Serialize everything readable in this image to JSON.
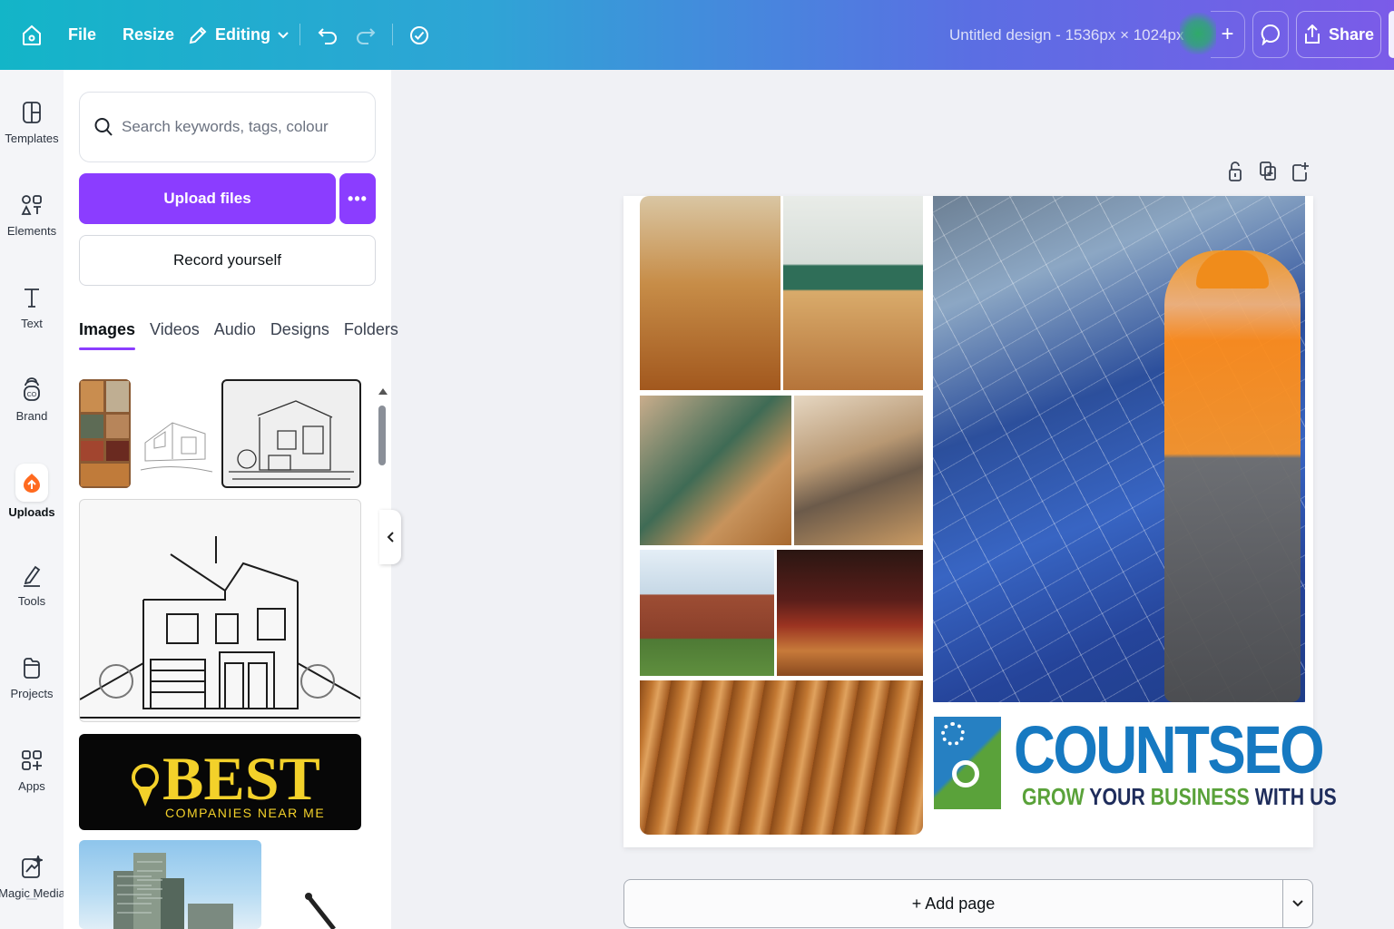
{
  "topbar": {
    "file": "File",
    "resize": "Resize",
    "editing": "Editing",
    "title": "Untitled design - 1536px × 1024px",
    "add": "+",
    "share": "Share"
  },
  "rail": {
    "items": [
      {
        "label": "Templates",
        "icon": "templates-icon"
      },
      {
        "label": "Elements",
        "icon": "elements-icon"
      },
      {
        "label": "Text",
        "icon": "text-icon"
      },
      {
        "label": "Brand",
        "icon": "brand-icon"
      },
      {
        "label": "Uploads",
        "icon": "uploads-icon"
      },
      {
        "label": "Tools",
        "icon": "tools-icon"
      },
      {
        "label": "Projects",
        "icon": "projects-icon"
      },
      {
        "label": "Apps",
        "icon": "apps-icon"
      },
      {
        "label": "Magic Media",
        "icon": "magic-media-icon"
      }
    ],
    "active": "Uploads"
  },
  "panel": {
    "search_placeholder": "Search keywords, tags, colour",
    "upload_label": "Upload files",
    "more_label": "•••",
    "record_label": "Record yourself",
    "tabs": [
      "Images",
      "Videos",
      "Audio",
      "Designs",
      "Folders"
    ],
    "active_tab": "Images",
    "best_logo": {
      "word": "BEST",
      "sub": "COMPANIES NEAR ME"
    }
  },
  "canvas": {
    "logo_title": "COUNTSEO",
    "tagline": {
      "w1": "GROW",
      "w2": "YOUR",
      "w3": "BUSINESS",
      "w4": "WITH US"
    },
    "add_page": "+ Add page"
  },
  "colors": {
    "accent": "#8b3dff",
    "countseo_blue": "#1679c1",
    "countseo_green": "#5aa23a"
  }
}
